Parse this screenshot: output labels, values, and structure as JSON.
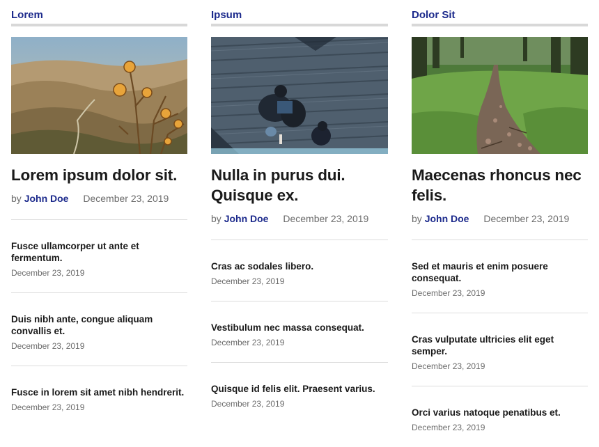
{
  "columns": [
    {
      "category": "Lorem",
      "feature": {
        "title": "Lorem ipsum dolor sit.",
        "by": "by",
        "author": "John Doe",
        "date": "December 23, 2019"
      },
      "items": [
        {
          "title": "Fusce ullamcorper ut ante et fermentum.",
          "date": "December 23, 2019"
        },
        {
          "title": "Duis nibh ante, congue aliquam convallis et.",
          "date": "December 23, 2019"
        },
        {
          "title": "Fusce in lorem sit amet nibh hendrerit.",
          "date": "December 23, 2019"
        }
      ]
    },
    {
      "category": "Ipsum",
      "feature": {
        "title": "Nulla in purus dui. Quisque ex.",
        "by": "by",
        "author": "John Doe",
        "date": "December 23, 2019"
      },
      "items": [
        {
          "title": "Cras ac sodales libero.",
          "date": "December 23, 2019"
        },
        {
          "title": "Vestibulum nec massa consequat.",
          "date": "December 23, 2019"
        },
        {
          "title": "Quisque id felis elit. Praesent varius.",
          "date": "December 23, 2019"
        }
      ]
    },
    {
      "category": "Dolor Sit",
      "feature": {
        "title": "Maecenas rhoncus nec felis.",
        "by": "by",
        "author": "John Doe",
        "date": "December 23, 2019"
      },
      "items": [
        {
          "title": "Sed et mauris et enim posuere consequat.",
          "date": "December 23, 2019"
        },
        {
          "title": "Cras vulputate ultricies elit eget semper.",
          "date": "December 23, 2019"
        },
        {
          "title": "Orci varius natoque penatibus et.",
          "date": "December 23, 2019"
        }
      ]
    }
  ],
  "colors": {
    "accent": "#1c2a8c",
    "meta": "#6b6b6b",
    "rule": "#d8d8d8"
  }
}
